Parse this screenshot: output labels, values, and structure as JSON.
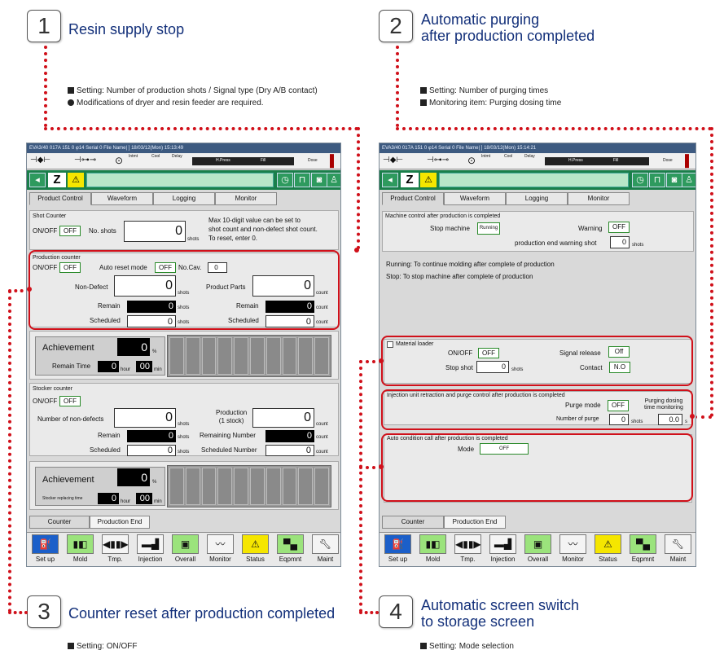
{
  "callouts": [
    {
      "num": "1",
      "title": "Resin supply stop",
      "notes": [
        "Setting: Number of production shots / Signal type (Dry A/B contact)",
        "Modifications of dryer and resin feeder are required."
      ]
    },
    {
      "num": "2",
      "title": "Automatic purging\nafter production completed",
      "notes": [
        "Setting: Number of purging times",
        "Monitoring item: Purging dosing time"
      ]
    },
    {
      "num": "3",
      "title": "Counter reset after production completed",
      "notes": [
        "Setting: ON/OFF"
      ]
    },
    {
      "num": "4",
      "title": "Automatic screen switch\nto storage screen",
      "notes": [
        "Setting: Mode selection"
      ]
    }
  ],
  "left_screen": {
    "topbar": "EVA3/40 017A   151  0     φ14  Serial  0     File Name|                                                         ]    18/03/12(Mon)  15:13:49",
    "icon_labels": {
      "intmt": "Intmt",
      "cool": "Cool",
      "delay": "Delay",
      "hpress": "H.Press",
      "fill": "Fill",
      "dose": "Dose"
    },
    "tabs": [
      "Product Control",
      "Waveform",
      "Logging",
      "Monitor"
    ],
    "shot_counter": {
      "title": "Shot Counter",
      "onoff_label": "ON/OFF",
      "onoff_value": "OFF",
      "no_shots_label": "No. shots",
      "no_shots_value": "0",
      "unit": "shots",
      "help": "Max 10-digit value can be set to\nshot count and non-defect shot count.\nTo reset, enter 0."
    },
    "production_counter": {
      "title": "Production counter",
      "onoff_label": "ON/OFF",
      "onoff_value": "OFF",
      "auto_reset_label": "Auto reset mode",
      "auto_reset_value": "OFF",
      "nocav_label": "No.Cav.",
      "nocav_value": "0",
      "non_defect_label": "Non-Defect",
      "non_defect_value": "0",
      "product_parts_label": "Product Parts",
      "product_parts_value": "0",
      "remain_label": "Remain",
      "remain_value": "0",
      "remain2_value": "0",
      "scheduled_label": "Scheduled",
      "scheduled_value": "0",
      "scheduled2_value": "0",
      "unit_shots": "shots",
      "unit_count": "count"
    },
    "achievement": {
      "label": "Achievement",
      "value": "0",
      "pct": "%",
      "remain_time_label": "Remain Time",
      "hour_value": "0",
      "hour_unit": "hour",
      "min_value": "00",
      "min_unit": "min"
    },
    "stocker_counter": {
      "title": "Stocker counter",
      "onoff_label": "ON/OFF",
      "onoff_value": "OFF",
      "non_defects_label": "Number of non-defects",
      "non_defects_value": "0",
      "production_label": "Production\n(1 stock)",
      "production_value": "0",
      "remain_label": "Remain",
      "remain_value": "0",
      "remaining_number_label": "Remaining Number",
      "remaining_number_value": "0",
      "scheduled_label": "Scheduled",
      "scheduled_value": "0",
      "scheduled_number_label": "Scheduled Number",
      "scheduled_number_value": "0",
      "unit_shots": "shots",
      "unit_count": "count"
    },
    "stocker_achievement": {
      "label": "Achievement",
      "value": "0",
      "pct": "%",
      "replacing_label": "Stocker replacing time",
      "hour_value": "0",
      "hour_unit": "hour",
      "min_value": "00",
      "min_unit": "min"
    },
    "bottom_tabs": [
      "Counter",
      "Production End"
    ],
    "nav": [
      "Set up",
      "Mold",
      "Tmp.",
      "Injection",
      "Overall",
      "Monitor",
      "Status",
      "Eqpmnt",
      "Maint"
    ]
  },
  "right_screen": {
    "topbar": "EVA3/40 017A   151  0     φ14  Serial  0     File Name|                                                         ]    18/03/12(Mon)  15:14:21",
    "icon_labels": {
      "intmt": "Intmt",
      "cool": "Cool",
      "delay": "Delay",
      "hpress": "H.Press",
      "fill": "Fill",
      "dose": "Dose"
    },
    "tabs": [
      "Product Control",
      "Waveform",
      "Logging",
      "Monitor"
    ],
    "machine_control": {
      "title": "Machine control after production is completed",
      "stop_machine_label": "Stop machine",
      "stop_machine_value": "Running",
      "warning_label": "Warning",
      "warning_value": "OFF",
      "end_warning_label": "production end warning shot",
      "end_warning_value": "0",
      "unit": "shots"
    },
    "desc_running": "Running: To continue molding after complete of production",
    "desc_stop": "Stop: To stop machine after complete of  production",
    "material_loader": {
      "title": "Material loader",
      "onoff_label": "ON/OFF",
      "onoff_value": "OFF",
      "signal_release_label": "Signal release",
      "signal_release_value": "Off",
      "stop_shot_label": "Stop shot",
      "stop_shot_value": "0",
      "unit": "shots",
      "contact_label": "Contact",
      "contact_value": "N.O"
    },
    "purge_control": {
      "title": "Injection unit retraction and purge control after production is completed",
      "purge_mode_label": "Purge mode",
      "purge_mode_value": "OFF",
      "number_of_purge_label": "Number of purge",
      "number_of_purge_value": "0",
      "unit": "shots",
      "dosing_label": "Purging dosing\ntime monitoring",
      "dosing_value": "0.0",
      "dosing_unit": "s"
    },
    "auto_condition": {
      "title": "Auto condition call after production is completed",
      "mode_label": "Mode",
      "mode_value": "OFF"
    },
    "bottom_tabs": [
      "Counter",
      "Production End"
    ],
    "nav": [
      "Set up",
      "Mold",
      "Tmp.",
      "Injection",
      "Overall",
      "Monitor",
      "Status",
      "Eqpmnt",
      "Maint"
    ]
  },
  "colors": {
    "accent_red": "#d0101a",
    "title_blue": "#13307a",
    "screen_green": "#1a7f4a"
  }
}
